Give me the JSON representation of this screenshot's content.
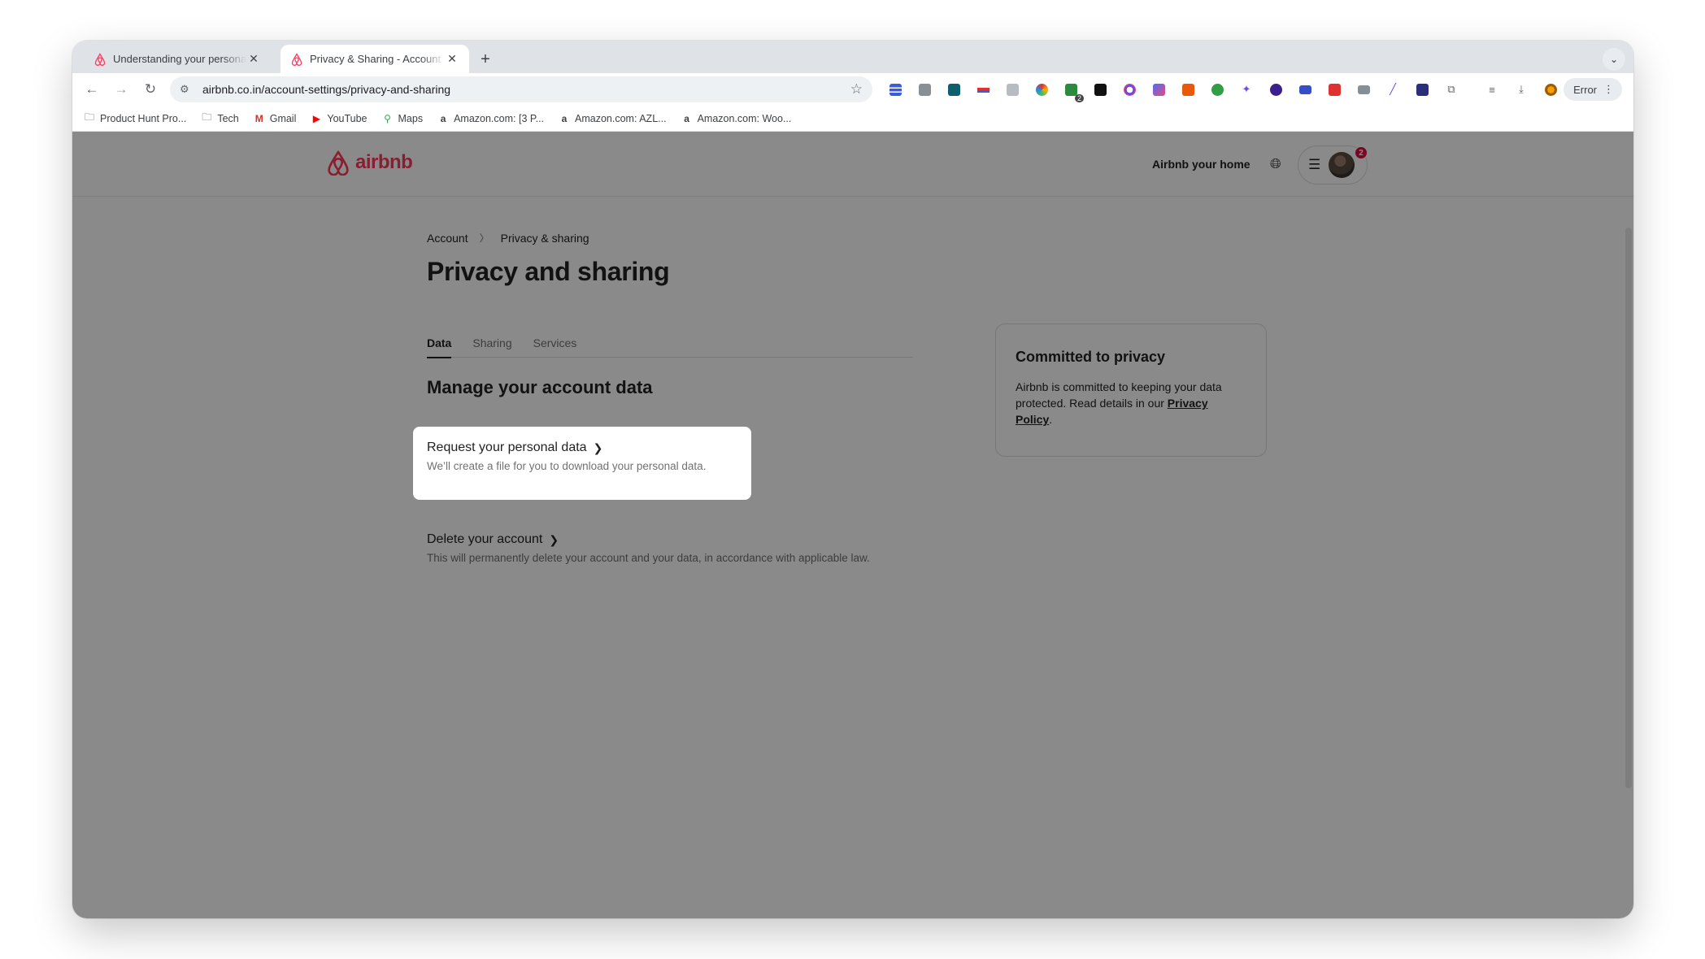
{
  "browser": {
    "tabs": [
      {
        "title": "Understanding your personal",
        "close": "✕"
      },
      {
        "title": "Privacy & Sharing - Account",
        "close": "✕"
      }
    ],
    "new_tab": "+",
    "url": "airbnb.co.in/account-settings/privacy-and-sharing",
    "error_label": "Error",
    "bookmarks": [
      {
        "label": "Product Hunt Pro...",
        "icon": "folder-icon"
      },
      {
        "label": "Tech",
        "icon": "folder-icon"
      },
      {
        "label": "Gmail",
        "icon": "gmail-icon"
      },
      {
        "label": "YouTube",
        "icon": "youtube-icon"
      },
      {
        "label": "Maps",
        "icon": "maps-icon"
      },
      {
        "label": "Amazon.com: [3 P...",
        "icon": "amazon-icon"
      },
      {
        "label": "Amazon.com: AZL...",
        "icon": "amazon-icon"
      },
      {
        "label": "Amazon.com: Woo...",
        "icon": "amazon-icon"
      }
    ],
    "extension_badge": "2"
  },
  "header": {
    "logo_text": "airbnb",
    "host_link": "Airbnb your home",
    "notification_count": "2"
  },
  "breadcrumb": {
    "items": [
      "Account",
      "Privacy & sharing"
    ]
  },
  "page_title": "Privacy and sharing",
  "tabs": [
    "Data",
    "Sharing",
    "Services"
  ],
  "section_title": "Manage your account data",
  "items": {
    "request": {
      "title": "Request your personal data",
      "description": "We’ll create a file for you to download your personal data."
    },
    "delete": {
      "title": "Delete your account",
      "description": "This will permanently delete your account and your data, in accordance with applicable law."
    }
  },
  "privacy_card": {
    "title": "Committed to privacy",
    "body": "Airbnb is committed to keeping your data protected. Read details in our ",
    "link": "Privacy Policy",
    "after": "."
  },
  "colors": {
    "brand": "#ff385c",
    "overlay": "rgba(0,0,0,0.46)"
  }
}
